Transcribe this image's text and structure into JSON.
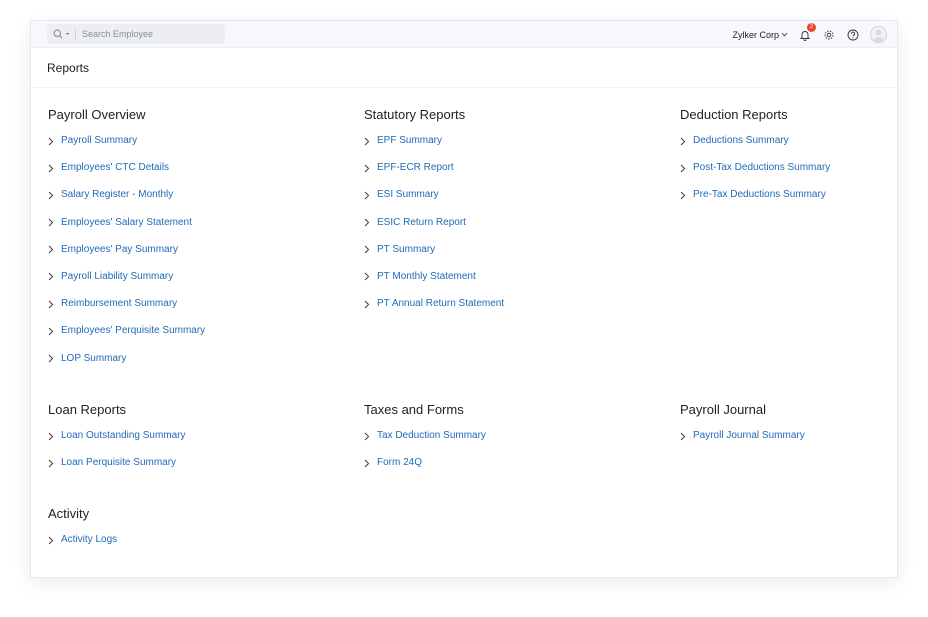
{
  "search": {
    "placeholder": "Search Employee"
  },
  "header": {
    "org_name": "Zylker Corp",
    "notification_count": "2"
  },
  "page": {
    "title": "Reports"
  },
  "colors": {
    "link": "#1f6ab8",
    "badge": "#e5482f"
  },
  "icons": [
    "search-icon",
    "chevron-down-icon",
    "bell-icon",
    "gear-icon",
    "help-icon",
    "avatar-icon",
    "chevron-right-icon"
  ],
  "sections": [
    {
      "title": "Payroll Overview",
      "items": [
        "Payroll Summary",
        "Employees' CTC Details",
        "Salary Register - Monthly",
        "Employees' Salary Statement",
        "Employees' Pay Summary",
        "Payroll Liability Summary",
        "Reimbursement Summary",
        "Employees' Perquisite Summary",
        "LOP Summary"
      ]
    },
    {
      "title": "Statutory Reports",
      "items": [
        "EPF Summary",
        "EPF-ECR Report",
        "ESI Summary",
        "ESIC Return Report",
        "PT Summary",
        "PT Monthly Statement",
        "PT Annual Return Statement"
      ]
    },
    {
      "title": "Deduction Reports",
      "items": [
        "Deductions Summary",
        "Post-Tax Deductions Summary",
        "Pre-Tax Deductions Summary"
      ]
    },
    {
      "title": "Loan Reports",
      "items": [
        "Loan Outstanding Summary",
        "Loan Perquisite Summary"
      ]
    },
    {
      "title": "Taxes and Forms",
      "items": [
        "Tax Deduction Summary",
        "Form 24Q"
      ]
    },
    {
      "title": "Payroll Journal",
      "items": [
        "Payroll Journal Summary"
      ]
    },
    {
      "title": "Activity",
      "items": [
        "Activity Logs"
      ]
    }
  ]
}
